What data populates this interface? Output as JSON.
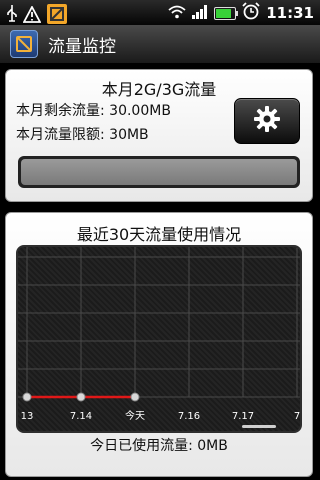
{
  "status": {
    "time": "11:31",
    "battery_level": 0.9,
    "icons": [
      "usb-icon",
      "warning-icon",
      "app-notification-icon",
      "wifi-icon",
      "signal-icon",
      "battery-icon",
      "alarm-icon"
    ]
  },
  "app": {
    "title": "流量监控"
  },
  "plan": {
    "heading": "本月2G/3G流量",
    "remaining": "本月剩余流量: 30.00MB",
    "limit": "本月流量限额: 30MB",
    "settings_icon": "gear-icon",
    "usage_fraction": 0
  },
  "history": {
    "heading": "最近30天流量使用情况",
    "today_used": "今日已使用流量: 0MB"
  },
  "colors": {
    "series": "#e01818",
    "point": "#d8d8d8",
    "grid": "#4a4a4a",
    "usage_fill": "#3cc43c"
  },
  "chart_data": {
    "type": "line",
    "title": "最近30天流量使用情况",
    "categories": [
      "13",
      "7.14",
      "今天",
      "7.16",
      "7.17",
      "7"
    ],
    "values": [
      0,
      0,
      0,
      null,
      null,
      null
    ],
    "ylim": [
      0,
      1
    ],
    "grid": true
  }
}
